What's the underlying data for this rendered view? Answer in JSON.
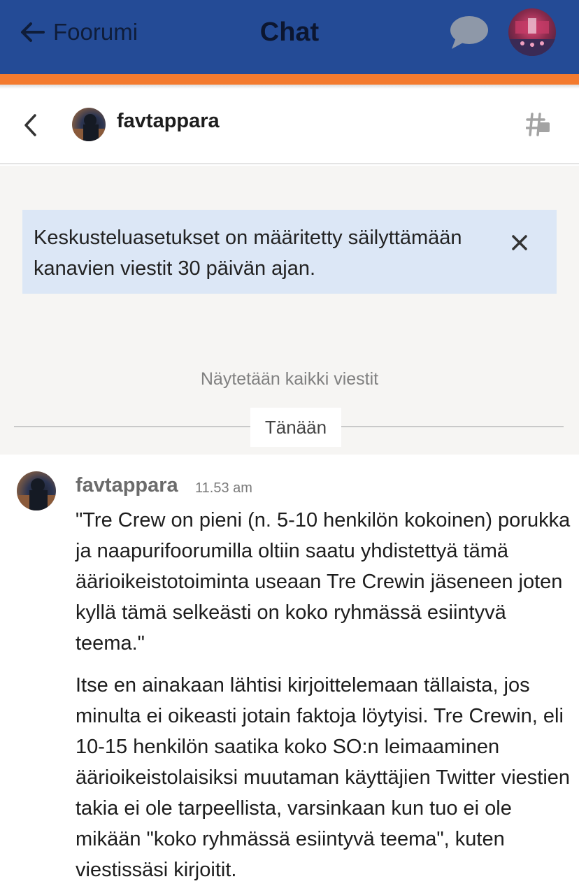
{
  "header": {
    "back_label": "Foorumi",
    "title": "Chat",
    "icons": {
      "back": "arrow-left-icon",
      "chat": "chat-bubble-icon",
      "avatar": "user-avatar"
    },
    "colors": {
      "bar": "#244b96",
      "stripe": "#f47b2f"
    }
  },
  "channel": {
    "name": "favtappara",
    "icons": {
      "back": "chevron-left-icon",
      "settings": "hash-settings-icon"
    }
  },
  "notice": {
    "text": "Keskusteluasetukset on määritetty säilyttämään kanavien viestit 30 päivän ajan.",
    "close_icon": "close-icon",
    "color": "#dce7f6"
  },
  "feed": {
    "show_all_label": "Näytetään kaikki viestit",
    "date_divider": "Tänään"
  },
  "message": {
    "author": "favtappara",
    "time": "11.53 am",
    "paragraphs": [
      "\"Tre Crew on pieni (n. 5-10 henkilön kokoinen) porukka ja naapurifoorumilla oltiin saatu yhdistettyä tämä äärioikeistotoiminta useaan Tre Crewin jäseneen joten kyllä tämä selkeästi on koko ryhmässä esiintyvä teema.\"",
      "Itse en ainakaan lähtisi kirjoittelemaan tällaista, jos minulta ei oikeasti jotain faktoja löytyisi. Tre Crewin, eli 10-15 henkilön saatika koko SO:n leimaaminen äärioikeistolaisiksi muutaman käyttäjien Twitter viestien takia ei ole tarpeellista, varsinkaan kun tuo ei ole mikään \"koko ryhmässä esiintyvä teema\", kuten viestissäsi kirjoitit."
    ]
  }
}
